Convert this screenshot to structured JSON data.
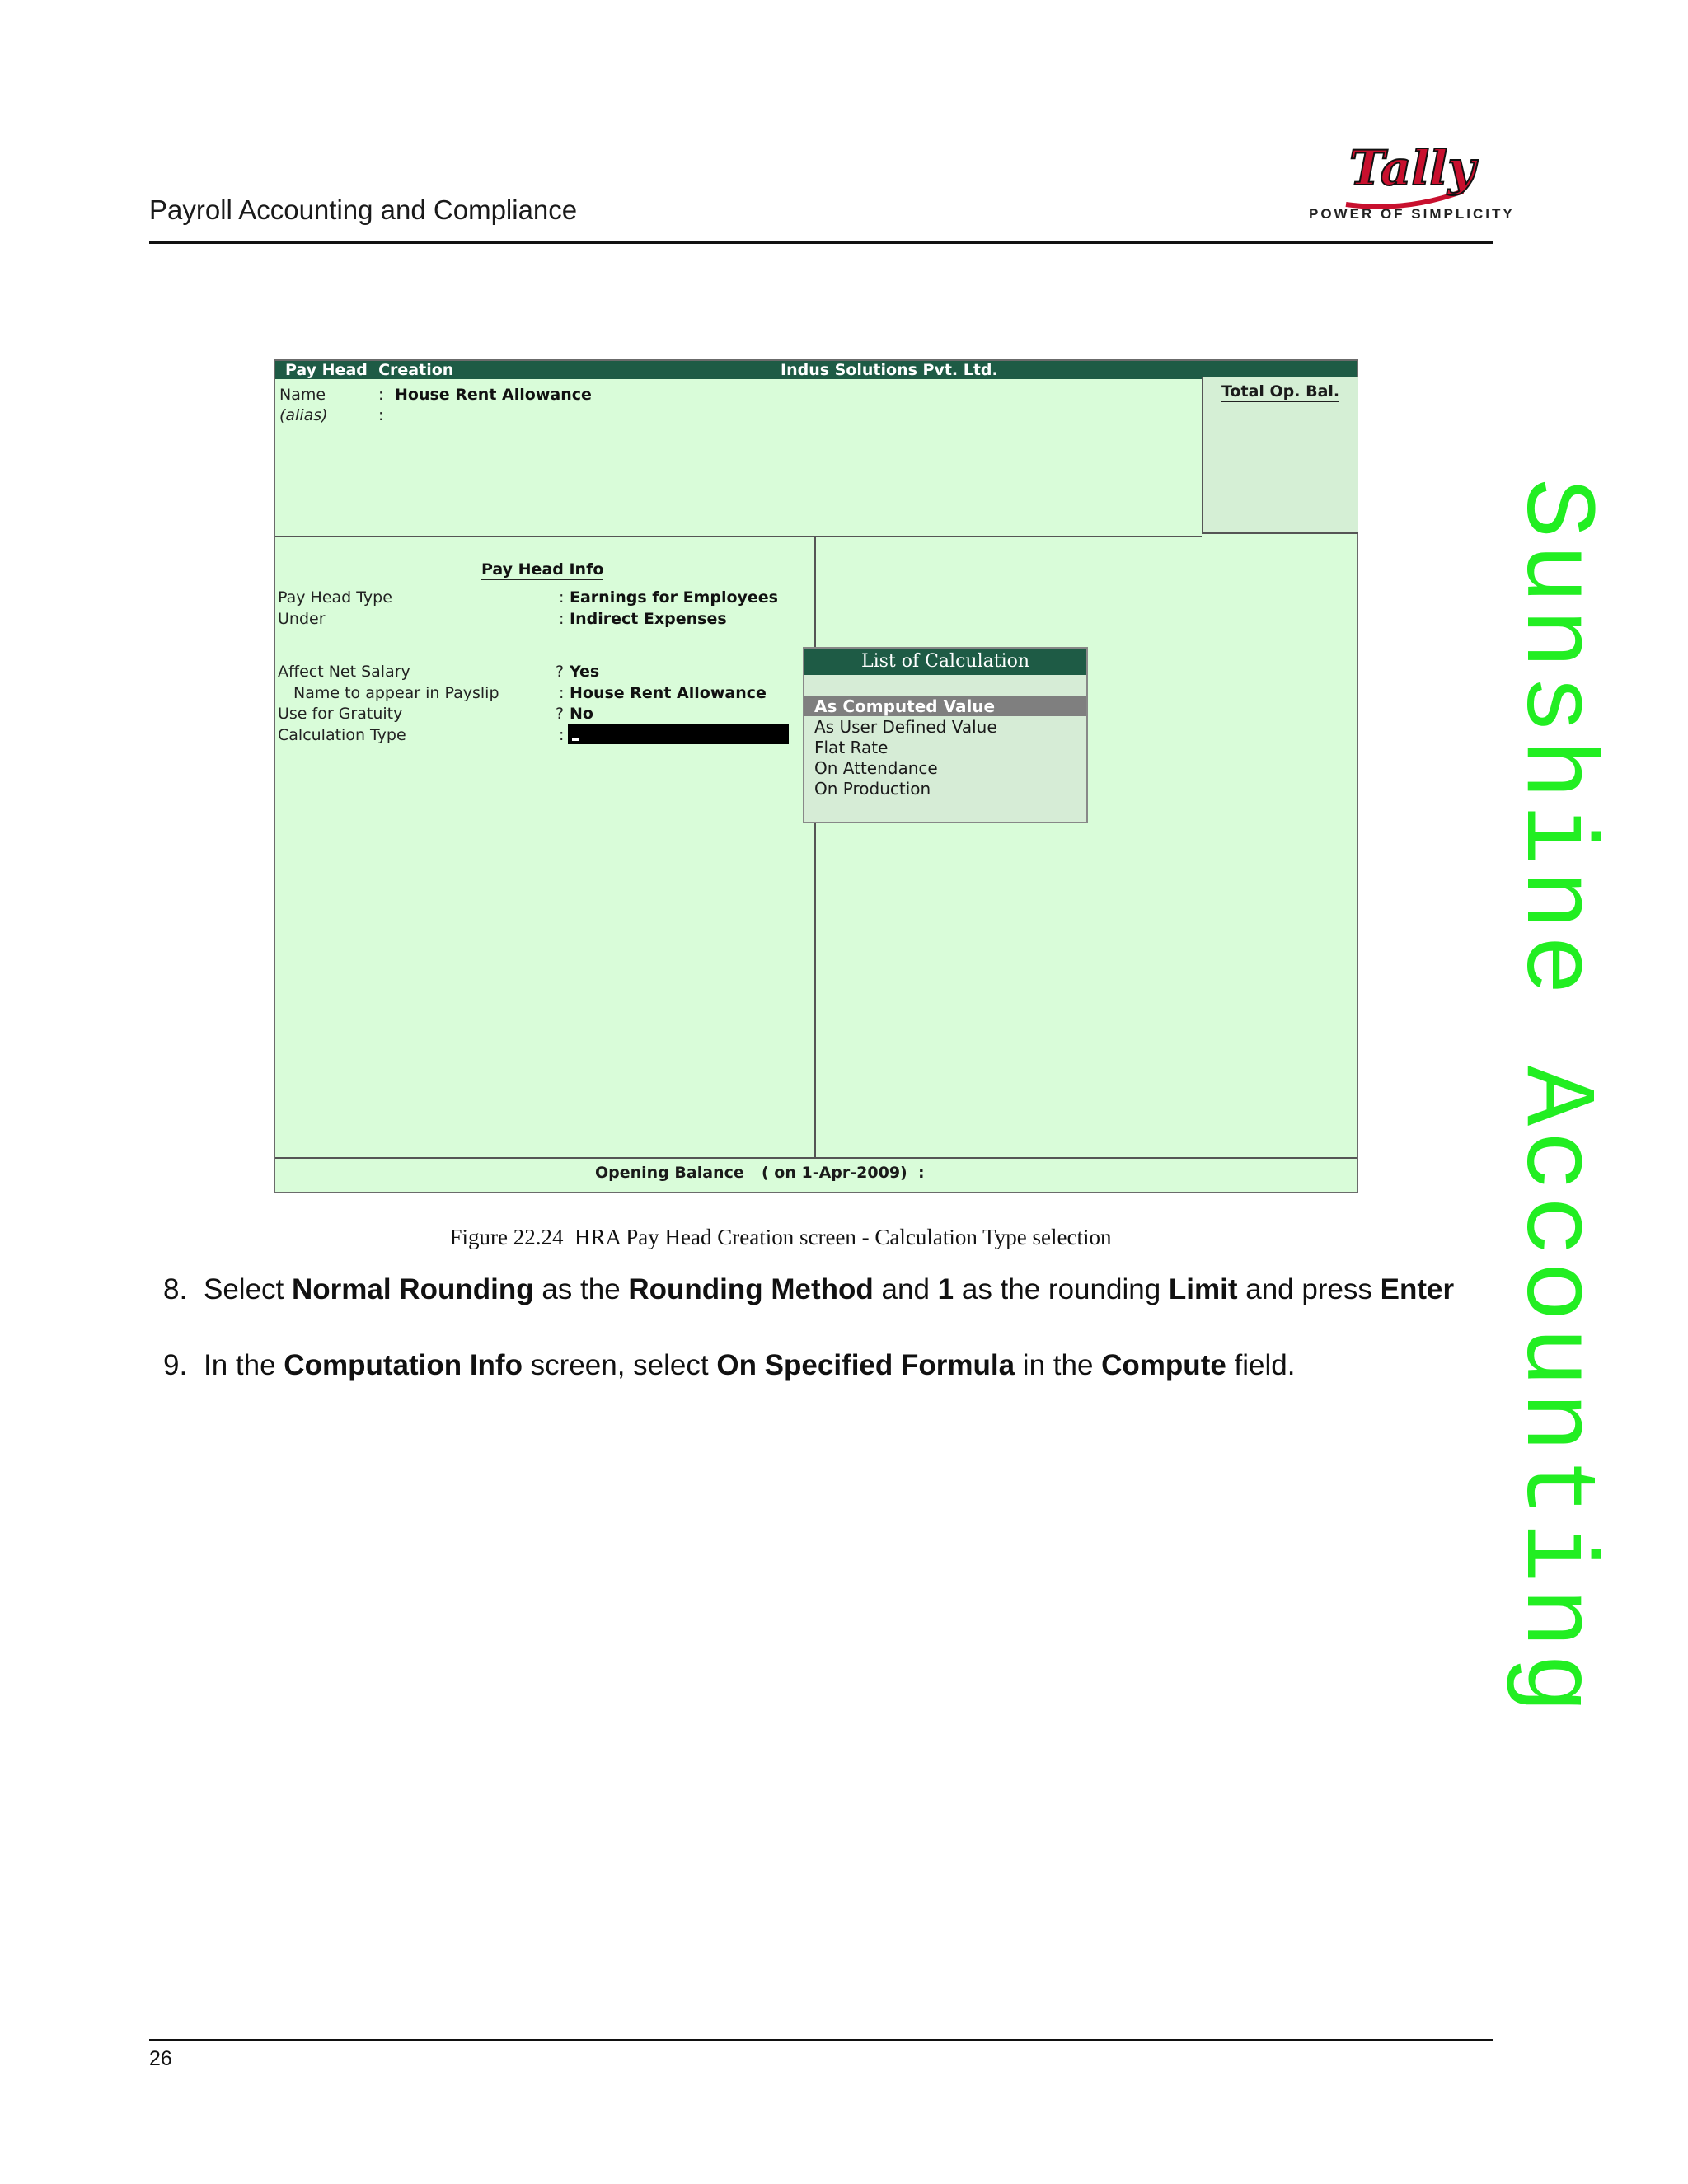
{
  "header": {
    "title": "Payroll Accounting and Compliance",
    "logo_text": "Tally",
    "logo_tagline": "POWER OF SIMPLICITY"
  },
  "watermark": "Sunshine Accounting",
  "screen": {
    "title_left": "Pay Head  Creation",
    "title_center": "Indus Solutions Pvt. Ltd.",
    "total_op_bal": "Total Op. Bal.",
    "name_label": "Name",
    "name_value": "House Rent Allowance",
    "alias_label": "(alias)",
    "section_title": "Pay Head Info",
    "fields": [
      {
        "label": "Pay Head Type",
        "sep": ":",
        "value": "Earnings for Employees"
      },
      {
        "label": "Under",
        "sep": ":",
        "value": "Indirect Expenses"
      },
      {
        "label": "Affect Net Salary",
        "sep": "?",
        "value": "Yes"
      },
      {
        "label": "Name to appear in Payslip",
        "sep": ":",
        "value": "House Rent Allowance"
      },
      {
        "label": "Use for Gratuity",
        "sep": "?",
        "value": "No"
      },
      {
        "label": "Calculation Type",
        "sep": ":",
        "value": ""
      }
    ],
    "popup": {
      "title": "List of Calculation",
      "selected": "As Computed Value",
      "items": [
        "As User Defined Value",
        "Flat Rate",
        "On Attendance",
        "On Production"
      ]
    },
    "footer": {
      "label": "Opening Balance",
      "date": "( on 1-Apr-2009)  :"
    }
  },
  "caption": "Figure 22.24  HRA Pay Head Creation screen - Calculation Type selection",
  "steps": [
    {
      "number": "8.",
      "parts": [
        "Select ",
        "Normal Rounding",
        " as the ",
        "Rounding Method",
        " and ",
        "1",
        " as the rounding ",
        "Limit",
        " and press ",
        "Enter"
      ]
    },
    {
      "number": "9.",
      "parts": [
        "In the ",
        "Computation Info",
        " screen, select ",
        "On Specified Formula",
        " in the ",
        "Compute",
        " field."
      ]
    }
  ],
  "page_number": "26",
  "colors": {
    "screen_bg": "#d9fcd9",
    "title_bar": "#1e5b45",
    "watermark": "#22ee22",
    "selected_item": "#7f7f7f"
  }
}
